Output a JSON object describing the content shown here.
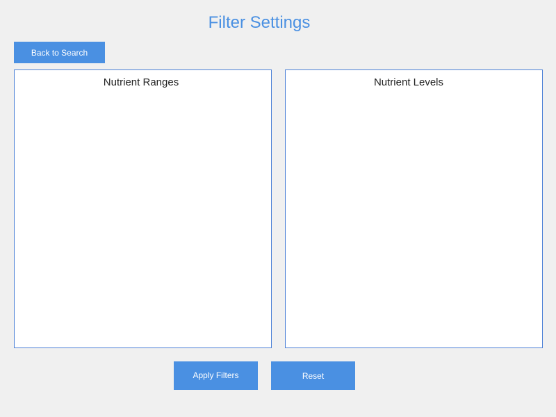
{
  "header": {
    "title": "Filter Settings"
  },
  "nav": {
    "back_label": "Back to Search"
  },
  "panels": {
    "ranges": {
      "title": "Nutrient Ranges"
    },
    "levels": {
      "title": "Nutrient Levels"
    }
  },
  "actions": {
    "apply_label": "Apply Filters",
    "reset_label": "Reset"
  },
  "colors": {
    "accent": "#4a90e2",
    "background": "#f0f0f0",
    "panel_border": "#4a7fd6"
  }
}
